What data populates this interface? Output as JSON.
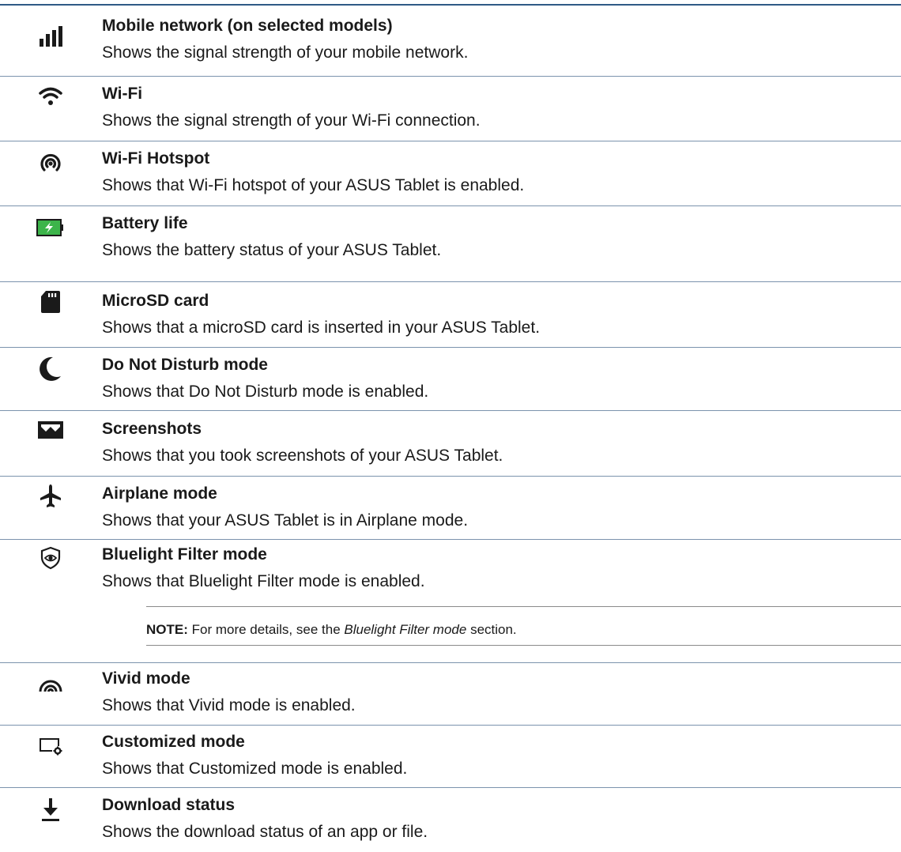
{
  "items": [
    {
      "icon": "mobile-signal-icon",
      "title": "Mobile network (on selected models)",
      "description": "Shows the signal strength of your mobile network."
    },
    {
      "icon": "wifi-icon",
      "title": "Wi-Fi",
      "description": "Shows the signal strength of your Wi-Fi connection."
    },
    {
      "icon": "hotspot-icon",
      "title": "Wi-Fi Hotspot",
      "description": "Shows that Wi-Fi hotspot of your ASUS Tablet is enabled."
    },
    {
      "icon": "battery-charging-icon",
      "title": "Battery life",
      "description": "Shows the battery status of your ASUS Tablet."
    },
    {
      "icon": "microsd-card-icon",
      "title": "MicroSD card",
      "description": "Shows that a microSD card is inserted in your ASUS Tablet."
    },
    {
      "icon": "moon-icon",
      "title": "Do Not Disturb mode",
      "description": "Shows that Do Not Disturb mode is enabled."
    },
    {
      "icon": "screenshot-icon",
      "title": "Screenshots",
      "description": "Shows that you took screenshots of your ASUS Tablet."
    },
    {
      "icon": "airplane-icon",
      "title": "Airplane mode",
      "description": "Shows that your ASUS Tablet is in Airplane mode."
    },
    {
      "icon": "bluelight-shield-eye-icon",
      "title": "Bluelight Filter mode",
      "description": "Shows that Bluelight Filter mode is enabled."
    },
    {
      "icon": "vivid-mode-icon",
      "title": "Vivid mode",
      "description": "Shows that Vivid mode is enabled."
    },
    {
      "icon": "customized-mode-icon",
      "title": "Customized mode",
      "description": "Shows that Customized mode is enabled."
    },
    {
      "icon": "download-icon",
      "title": "Download status",
      "description": "Shows the download status of an app or file."
    }
  ],
  "note": {
    "label": "NOTE:",
    "text_before": " For more details, see the ",
    "italic": "Bluelight Filter mode",
    "text_after": " section."
  },
  "colors": {
    "rule": "#7b93ad",
    "top_rule": "#2f5a86",
    "battery_green": "#3cb44a",
    "text": "#1a1a1a"
  }
}
